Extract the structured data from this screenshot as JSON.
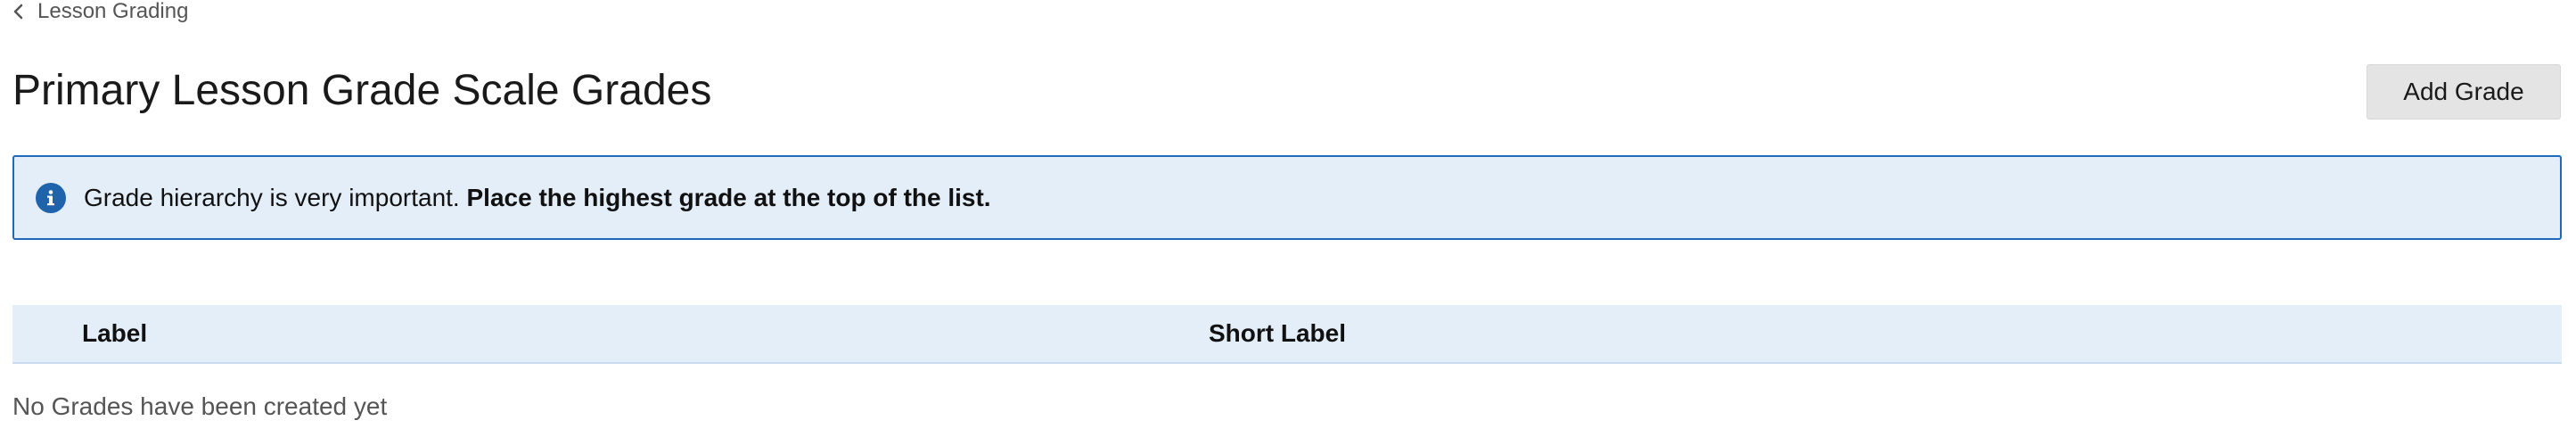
{
  "breadcrumb": {
    "icon": "chevron-left-icon",
    "label": "Lesson Grading"
  },
  "page": {
    "title": "Primary Lesson Grade Scale Grades"
  },
  "toolbar": {
    "add_label": "Add Grade"
  },
  "banner": {
    "icon": "info-icon",
    "text_normal": "Grade hierarchy is very important.",
    "text_bold": "Place the highest grade at the top of the list."
  },
  "table": {
    "columns": [
      "Label",
      "Short Label"
    ],
    "empty_message": "No Grades have been created yet"
  },
  "colors": {
    "banner_bg": "#e3eef9",
    "banner_border": "#1f6bb8",
    "info_icon": "#1f63ad",
    "button_bg": "#e4e4e4"
  }
}
